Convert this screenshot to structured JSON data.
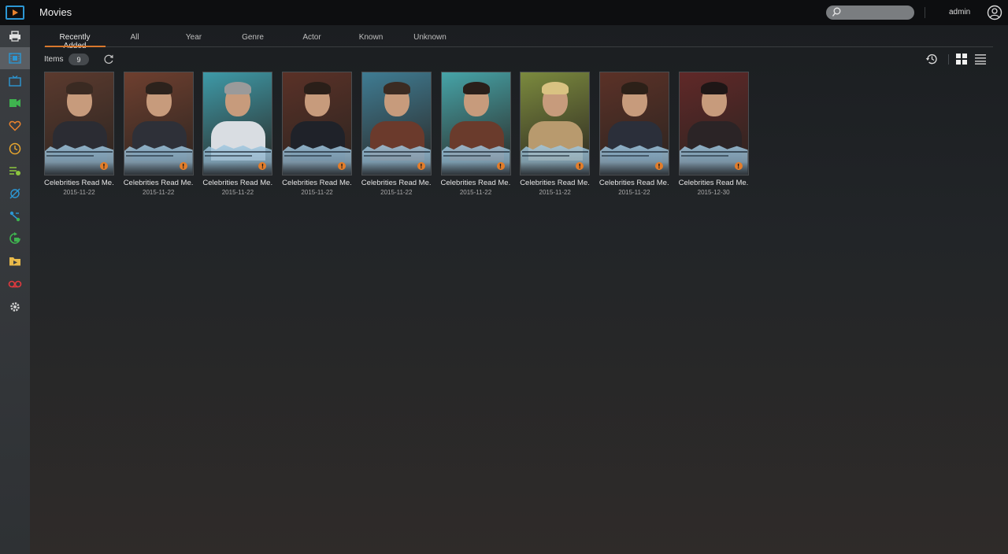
{
  "header": {
    "title": "Movies",
    "search_placeholder": "",
    "user_name": "admin"
  },
  "sidebar": {
    "items": [
      {
        "icon": "printer-icon",
        "color": "#e0e0e0"
      },
      {
        "icon": "film-icon",
        "color": "#2c97d4",
        "active": true
      },
      {
        "icon": "tv-icon",
        "color": "#2c97d4"
      },
      {
        "icon": "video-folder-icon",
        "color": "#3fb34f"
      },
      {
        "icon": "heart-icon",
        "color": "#e8822e"
      },
      {
        "icon": "clock-icon",
        "color": "#e8a62e"
      },
      {
        "icon": "playlist-icon",
        "color": "#8dc63f"
      },
      {
        "icon": "shared-link-icon",
        "color": "#2c97d4"
      },
      {
        "icon": "share-icon",
        "color": "#2c97d4"
      },
      {
        "icon": "convert-icon",
        "color": "#3fb34f"
      },
      {
        "icon": "folder-icon",
        "color": "#e8b94a"
      },
      {
        "icon": "tv-recorder-icon",
        "color": "#e0393e"
      },
      {
        "icon": "settings-icon",
        "color": "#cfcfcf"
      }
    ]
  },
  "tabs": [
    {
      "label": "Recently Added",
      "active": true
    },
    {
      "label": "All"
    },
    {
      "label": "Year"
    },
    {
      "label": "Genre"
    },
    {
      "label": "Actor"
    },
    {
      "label": "Known"
    },
    {
      "label": "Unknown"
    }
  ],
  "toolbar": {
    "items_label": "Items",
    "items_count": "9"
  },
  "videos": [
    {
      "title": "Celebrities Read Me...",
      "date": "2015-11-22",
      "bg": "#5b3a2e",
      "shirt": "#2b2c33",
      "hair": "#3a2a22"
    },
    {
      "title": "Celebrities Read Me...",
      "date": "2015-11-22",
      "bg": "#6e3f2f",
      "shirt": "#2e3038",
      "hair": "#2c221c"
    },
    {
      "title": "Celebrities Read Me...",
      "date": "2015-11-22",
      "bg": "#3e9aa8",
      "shirt": "#d9dde2",
      "hair": "#9a9a9a"
    },
    {
      "title": "Celebrities Read Me...",
      "date": "2015-11-22",
      "bg": "#5a3127",
      "shirt": "#1f2229",
      "hair": "#2a1f19"
    },
    {
      "title": "Celebrities Read Me...",
      "date": "2015-11-22",
      "bg": "#3f7c93",
      "shirt": "#6b3a2c",
      "hair": "#3b2b22"
    },
    {
      "title": "Celebrities Read Me...",
      "date": "2015-11-22",
      "bg": "#46a4a8",
      "shirt": "#6a3b2c",
      "hair": "#2a1f1a"
    },
    {
      "title": "Celebrities Read Me...",
      "date": "2015-11-22",
      "bg": "#7b8a3e",
      "shirt": "#b89a6e",
      "hair": "#d9c282"
    },
    {
      "title": "Celebrities Read Me...",
      "date": "2015-11-22",
      "bg": "#5b3127",
      "shirt": "#2b2f3a",
      "hair": "#2c2018"
    },
    {
      "title": "Celebrities Read Me...",
      "date": "2015-12-30",
      "bg": "#602828",
      "shirt": "#2b2426",
      "hair": "#1e1616"
    }
  ]
}
